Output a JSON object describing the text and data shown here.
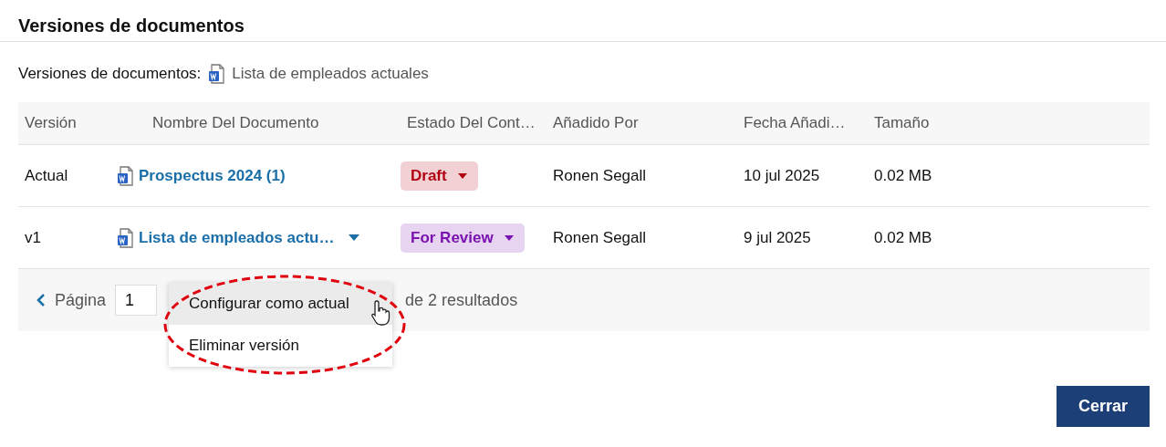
{
  "dialog": {
    "title": "Versiones de documentos"
  },
  "subtitle": {
    "label": "Versiones de documentos:",
    "document": "Lista de empleados actuales"
  },
  "table": {
    "columns": [
      "Versión",
      "Nombre Del Documento",
      "Estado Del Cont…",
      "Añadido Por",
      "Fecha Añadi…",
      "Tamaño"
    ],
    "rows": [
      {
        "version": "Actual",
        "name": "Prospectus 2024 (1)",
        "has_menu": false,
        "status": {
          "label": "Draft",
          "color": "#b00012"
        },
        "added_by": "Ronen Segall",
        "date": "10 jul 2025",
        "size": "0.02 MB"
      },
      {
        "version": "v1",
        "name": "Lista de empleados actu…",
        "has_menu": true,
        "status": {
          "label": "For Review",
          "color": "#7a12b0"
        },
        "added_by": "Ronen Segall",
        "date": "9 jul 2025",
        "size": "0.02 MB"
      }
    ]
  },
  "pagination": {
    "label": "Página",
    "page": "1",
    "summary": "de 2 resultados"
  },
  "menu": {
    "highlighted": true,
    "items": [
      {
        "label": "Configurar como actual",
        "selected": true
      },
      {
        "label": "Eliminar versión",
        "selected": false
      }
    ]
  },
  "buttons": [
    "Cerrar"
  ]
}
